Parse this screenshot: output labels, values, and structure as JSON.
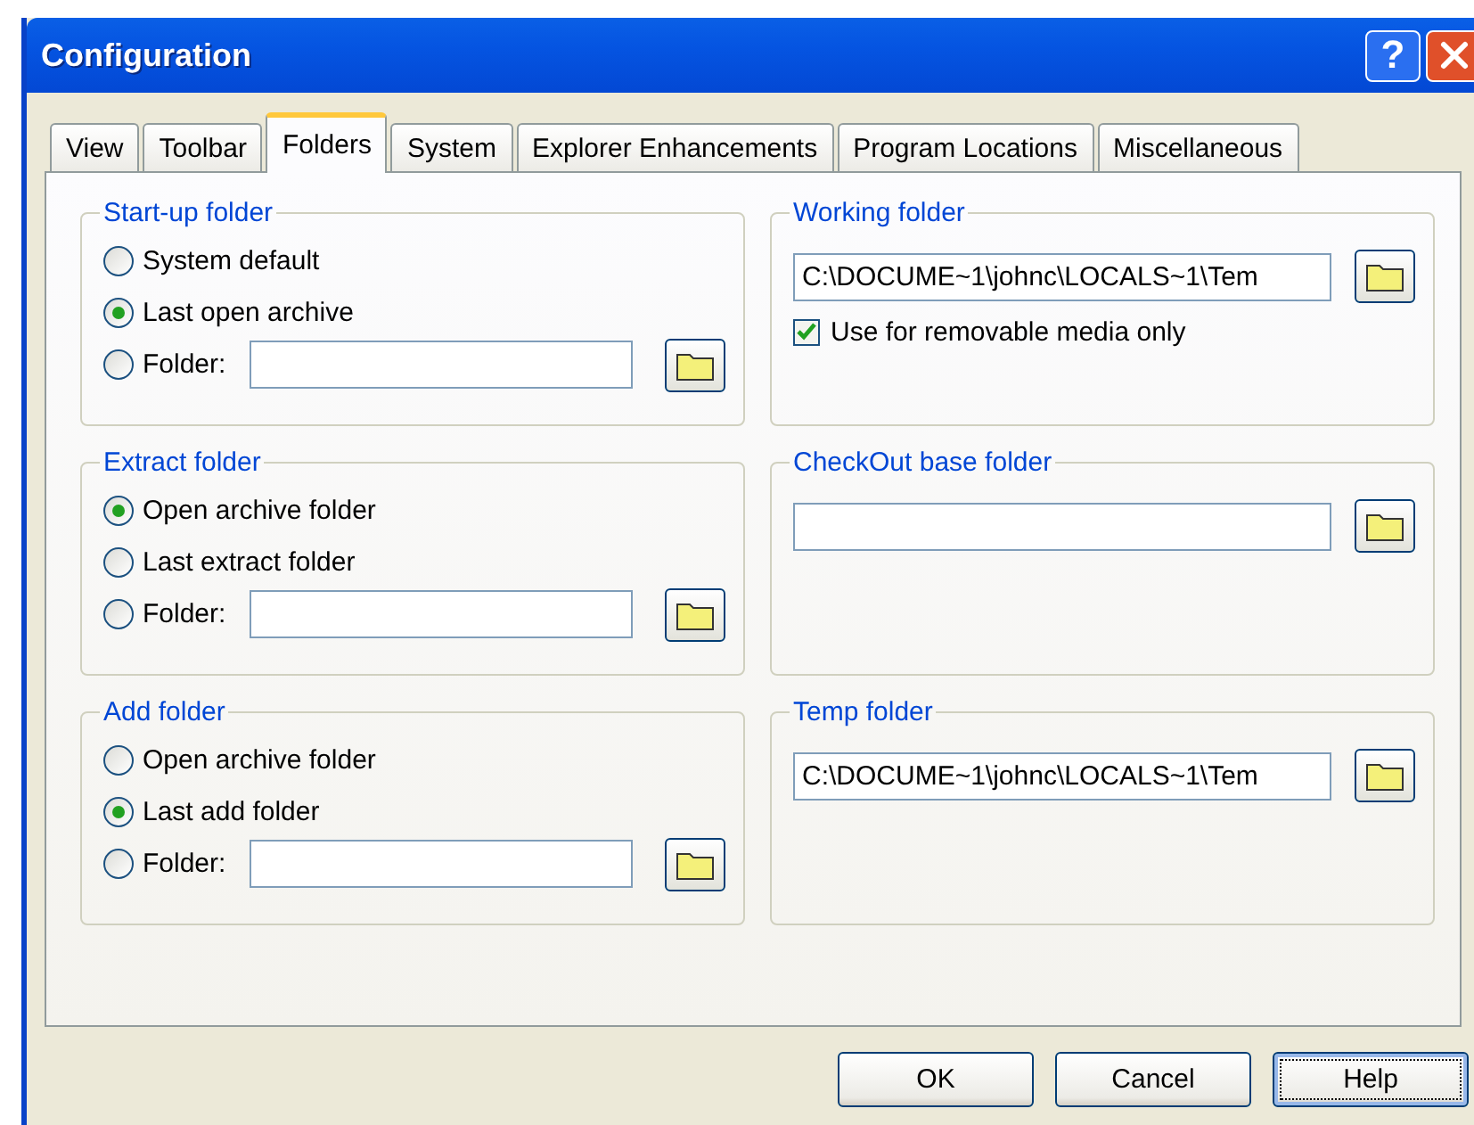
{
  "window": {
    "title": "Configuration",
    "help_glyph": "?"
  },
  "tabs": [
    {
      "label": "View",
      "selected": false
    },
    {
      "label": "Toolbar",
      "selected": false
    },
    {
      "label": "Folders",
      "selected": true
    },
    {
      "label": "System",
      "selected": false
    },
    {
      "label": "Explorer Enhancements",
      "selected": false
    },
    {
      "label": "Program Locations",
      "selected": false
    },
    {
      "label": "Miscellaneous",
      "selected": false
    }
  ],
  "left_groups": [
    {
      "title": "Start-up folder",
      "options": [
        {
          "kind": "radio",
          "label": "System default",
          "selected": false
        },
        {
          "kind": "radio",
          "label": "Last open archive",
          "selected": true
        },
        {
          "kind": "radio_field",
          "label": "Folder:",
          "selected": false
        }
      ]
    },
    {
      "title": "Extract folder",
      "options": [
        {
          "kind": "radio",
          "label": "Open archive folder",
          "selected": true
        },
        {
          "kind": "radio",
          "label": "Last extract folder",
          "selected": false
        },
        {
          "kind": "radio_field",
          "label": "Folder:",
          "selected": false
        }
      ]
    },
    {
      "title": "Add folder",
      "options": [
        {
          "kind": "radio",
          "label": "Open archive folder",
          "selected": false
        },
        {
          "kind": "radio",
          "label": "Last add folder",
          "selected": true
        },
        {
          "kind": "radio_field",
          "label": "Folder:",
          "selected": false
        }
      ]
    }
  ],
  "right_groups": [
    {
      "title": "Working folder",
      "field": {
        "value": "C:\\DOCUME~1\\johnc\\LOCALS~1\\Tem"
      },
      "checkbox": {
        "label": "Use for removable media only",
        "checked": true
      }
    },
    {
      "title": "CheckOut base folder"
    },
    {
      "title": "Temp folder",
      "field": {
        "value": "C:\\DOCUME~1\\johnc\\LOCALS~1\\Tem"
      }
    }
  ],
  "buttons": [
    {
      "label": "OK",
      "default": false
    },
    {
      "label": "Cancel",
      "default": false
    },
    {
      "label": "Help",
      "default": true
    }
  ]
}
